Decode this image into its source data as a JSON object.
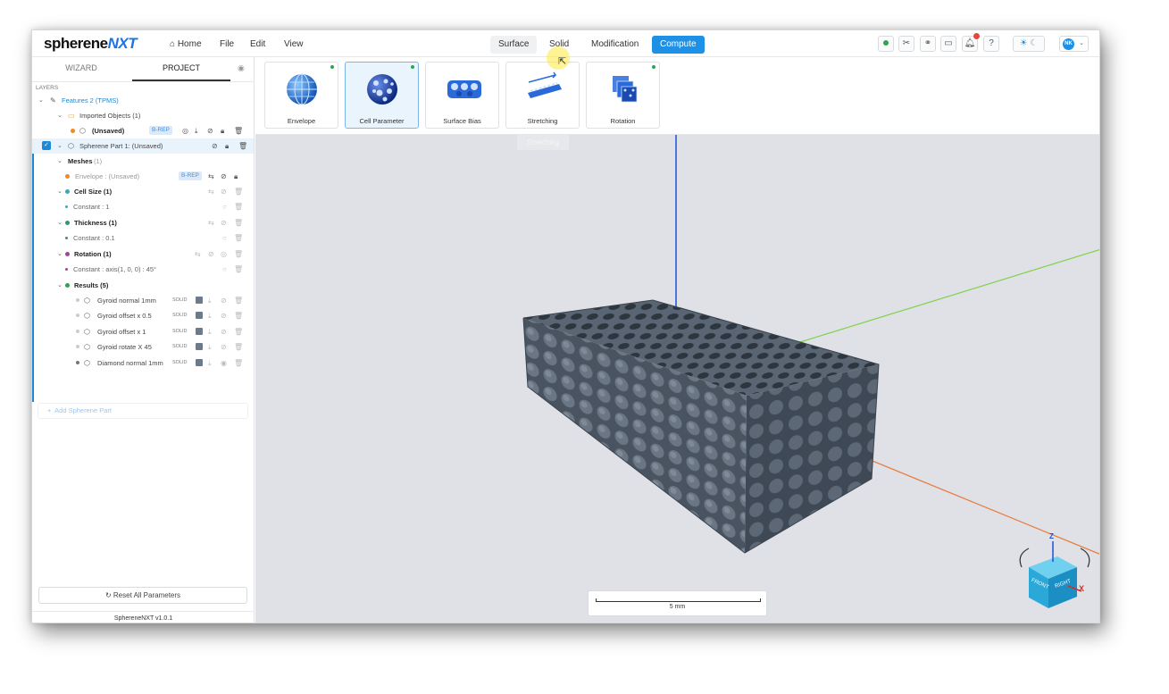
{
  "app": {
    "logo_main": "spherene",
    "logo_accent": "NXT",
    "version": "SphereneNXT v1.0.1"
  },
  "menu": {
    "home": "Home",
    "file": "File",
    "edit": "Edit",
    "view": "View"
  },
  "mode_tabs": {
    "surface": "Surface",
    "solid": "Solid",
    "modification": "Modification",
    "compute": "Compute"
  },
  "topbar_icons": [
    "status-dot",
    "tools",
    "link",
    "chat",
    "notification",
    "help",
    "theme-toggle"
  ],
  "user": {
    "initials": "NK"
  },
  "left_panel": {
    "tab_wizard": "WIZARD",
    "tab_project": "PROJECT",
    "layers_label": "LAYERS",
    "tree": {
      "features": "Features 2 (TPMS)",
      "imported_objects": "Imported Objects (1)",
      "unsaved": "(Unsaved)",
      "brep": "B-REP",
      "part": "Spherene Part 1: (Unsaved)",
      "meshes": "Meshes",
      "meshes_count": "(1)",
      "envelope": "Envelope : (Unsaved)",
      "cell_size": "Cell Size (1)",
      "cell_size_value": "Constant : 1",
      "thickness": "Thickness (1)",
      "thickness_value": "Constant : 0.1",
      "rotation": "Rotation (1)",
      "rotation_value": "Constant : axis(1, 0, 0) : 45°",
      "results": "Results (5)",
      "result_items": [
        "Gyroid normal 1mm",
        "Gyroid offset x 0.5",
        "Gyroid offset x 1",
        "Gyroid rotate X 45",
        "Diamond normal 1mm"
      ],
      "solid_label": "SOLID"
    },
    "add_part": "Add Spherene Part",
    "reset": "Reset All Parameters"
  },
  "ribbon": {
    "tools": [
      "Envelope",
      "Cell Parameter",
      "Surface Bias",
      "Stretching",
      "Rotation"
    ],
    "active": "Cell Parameter",
    "tooltip": "Stretching"
  },
  "viewport": {
    "scale_label": "5 mm",
    "gizmo": {
      "face_front": "FRONT",
      "face_right": "RIGHT",
      "axis_x": "X",
      "axis_z": "Z"
    }
  },
  "colors": {
    "accent": "#1e8ad6",
    "viewport_bg": "#dfe1e6",
    "model": "#4f5b68",
    "axis_x": "#e87a3a",
    "axis_y": "#7fd14a",
    "axis_z": "#2050d0"
  }
}
